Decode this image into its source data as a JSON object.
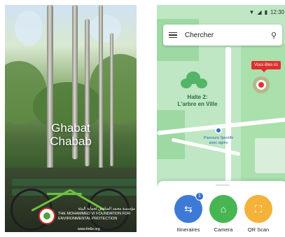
{
  "splash": {
    "title_line1": "Ghabat",
    "title_line2": "Chabab",
    "logo_text_ar": "مؤسسة محمد السادس لحماية البيئة",
    "logo_text_fr": "THE MOHAMMED VI FOUNDATION FOR ENVIRONMENTAL PROTECTION",
    "logo_url": "www.fm6e.org"
  },
  "phone": {
    "status_time": "12:30",
    "search": {
      "placeholder": "Chercher"
    },
    "map": {
      "you_are_here": "Vous êtes ici",
      "poi_main_line1": "Halte 2:",
      "poi_main_line2": "L'arbre en Ville",
      "poi_small_line1": "Parcours Sportifs",
      "poi_small_line2": "avec agrès"
    },
    "actions": [
      {
        "label": "Itineraires",
        "color": "#3d7ad6",
        "badge": "1"
      },
      {
        "label": "Camera",
        "color": "#47b652"
      },
      {
        "label": "QR Scan",
        "color": "#f4b23a"
      }
    ]
  },
  "colors": {
    "map_green": "#bfe7c4",
    "accent_blue": "#3d7ad6",
    "alert_red": "#e02d2d"
  }
}
